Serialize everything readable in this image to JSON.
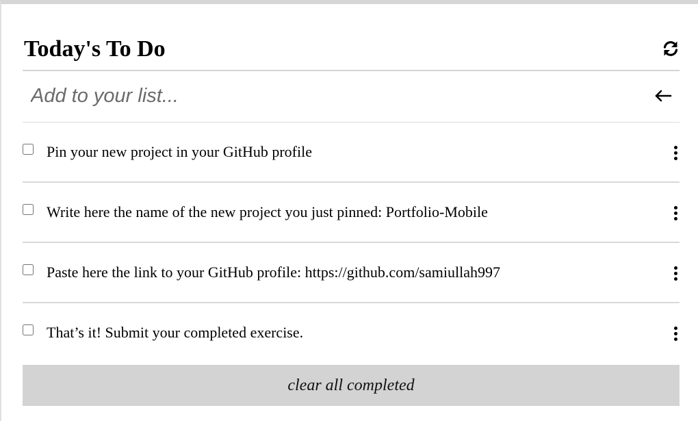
{
  "header": {
    "title": "Today's To Do",
    "refresh_icon": "refresh-icon"
  },
  "add": {
    "placeholder": "Add to your list...",
    "value": "",
    "submit_icon": "arrow-left-icon"
  },
  "todos": [
    {
      "text": "Pin your new project in your GitHub profile",
      "completed": false
    },
    {
      "text": "Write here the name of the new project you just pinned: Portfolio-Mobile",
      "completed": false
    },
    {
      "text": "Paste here the link to your GitHub profile: https://github.com/samiullah997",
      "completed": false
    },
    {
      "text": "That’s it! Submit your completed exercise.",
      "completed": false
    }
  ],
  "item_menu_icon": "more-vertical-icon",
  "footer": {
    "clear_label": "clear all completed"
  },
  "colors": {
    "divider": "#d4d4d4",
    "clear_button_bg": "#d3d3d3",
    "placeholder": "#6b6b6b"
  }
}
